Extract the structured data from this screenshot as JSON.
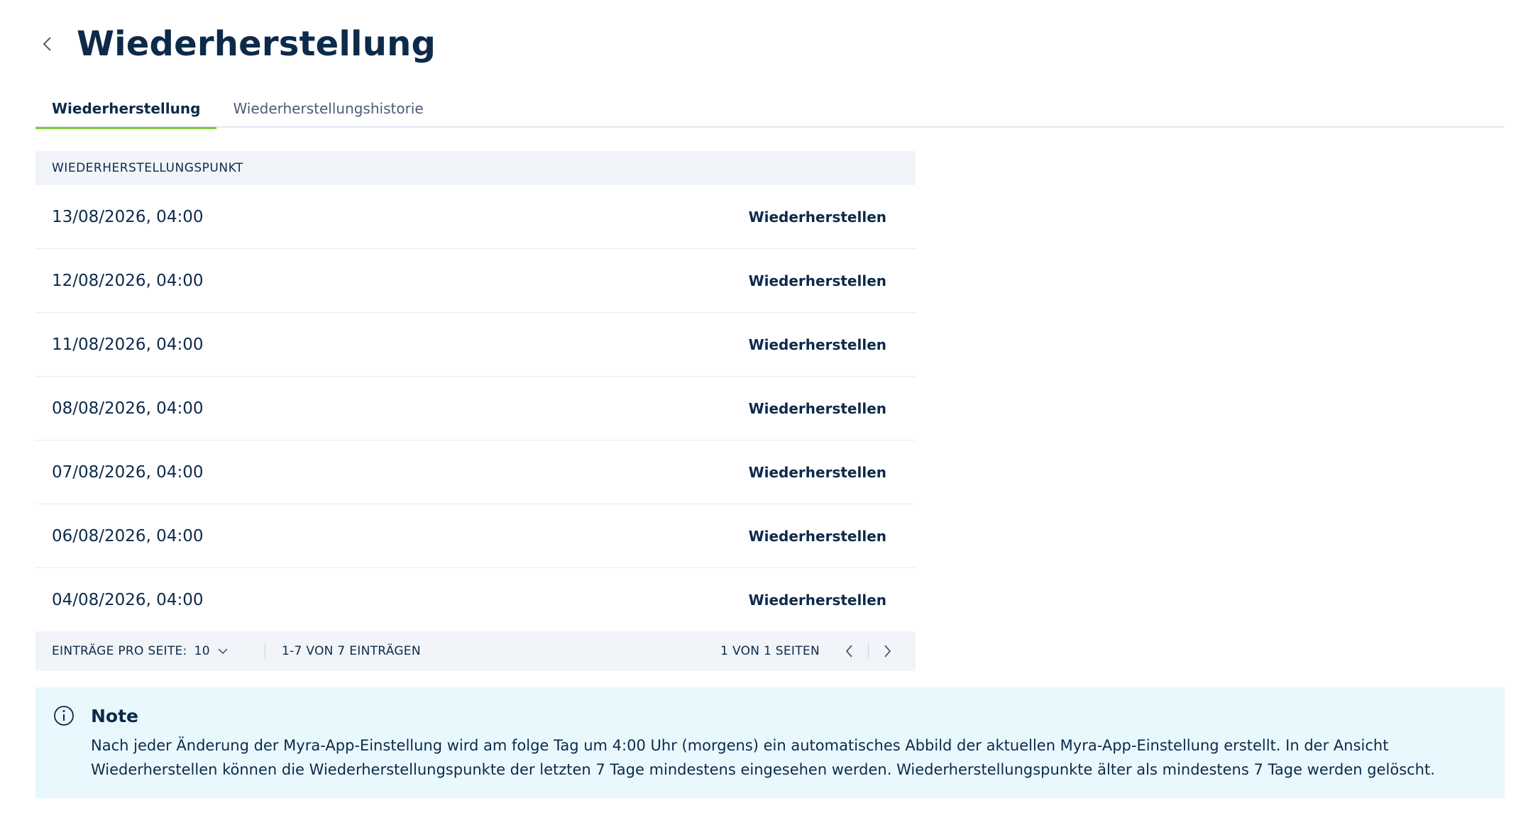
{
  "header": {
    "title": "Wiederherstellung"
  },
  "tabs": [
    {
      "label": "Wiederherstellung",
      "active": true
    },
    {
      "label": "Wiederherstellungshistorie",
      "active": false
    }
  ],
  "table": {
    "column_header": "WIEDERHERSTELLUNGSPUNKT",
    "action_label": "Wiederherstellen",
    "rows": [
      {
        "date": "13/08/2026, 04:00"
      },
      {
        "date": "12/08/2026, 04:00"
      },
      {
        "date": "11/08/2026, 04:00"
      },
      {
        "date": "08/08/2026, 04:00"
      },
      {
        "date": "07/08/2026, 04:00"
      },
      {
        "date": "06/08/2026, 04:00"
      },
      {
        "date": "04/08/2026, 04:00"
      }
    ]
  },
  "pagination": {
    "per_page_label": "EINTRÄGE PRO SEITE:",
    "per_page_value": "10",
    "range_text": "1-7 VON 7 EINTRÄGEN",
    "page_text": "1 VON 1 SEITEN"
  },
  "note": {
    "title": "Note",
    "text": "Nach jeder Änderung der Myra-App-Einstellung wird am folge Tag um 4:00 Uhr (morgens) ein automatisches Abbild der aktuellen Myra-App-Einstellung erstellt. In der Ansicht Wiederherstellen können die Wiederherstellungspunkte der letzten 7 Tage mindestens eingesehen werden. Wiederherstellungspunkte älter als mindestens 7 Tage werden gelöscht."
  },
  "colors": {
    "primary_text": "#0d2a4a",
    "tab_accent": "#7fcc3c",
    "table_header_bg": "#f1f4f8",
    "note_bg": "#e8f8fc"
  },
  "icons": {
    "back": "chevron-left-icon",
    "dropdown": "chevron-down-icon",
    "prev": "chevron-left-icon",
    "next": "chevron-right-icon",
    "note": "info-circle-icon"
  }
}
